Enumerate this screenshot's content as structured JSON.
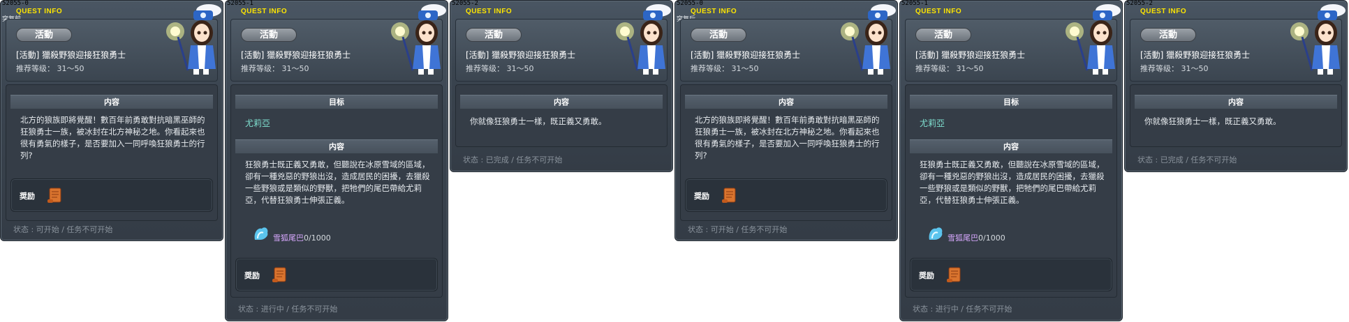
{
  "panels": [
    {
      "qid": "52055-0",
      "qinfo": "QUEST INFO",
      "subtag": "突复前",
      "badge": "活動",
      "title": "[活動] 獵殺野狼迎接狂狼勇士",
      "level": "推荐等级： 31～50",
      "content_header": "内容",
      "content": "北方的狼族即將覺醒！數百年前勇敢對抗暗黑巫師的狂狼勇士一族，被冰封在北方神秘之地。你看起來也很有勇氣的樣子，是否要加入一同呼喚狂狼勇士的行列?",
      "reward_label": "奨励",
      "status": "状态 : 可开始 / 任务不可开始"
    },
    {
      "qid": "52055-1",
      "qinfo": "QUEST INFO",
      "subtag": "",
      "badge": "活動",
      "title": "[活動] 獵殺野狼迎接狂狼勇士",
      "level": "推荐等级： 31～50",
      "target_header": "目标",
      "target_npc": "尤莉亞",
      "content_header": "内容",
      "content": "狂狼勇士既正義又勇敢，但聽說在冰原雪域的區域，卻有一種兇惡的野狼出沒，造成居民的困擾，去獵殺一些野狼或是類似的野獸，把牠們的尾巴帶給尤莉亞，代替狂狼勇士伸張正義。",
      "item_name": "雪狐尾巴",
      "item_count": "0/1000",
      "reward_label": "奨励",
      "status": "状态 : 进行中 / 任务不可开始"
    },
    {
      "qid": "52055-2",
      "qinfo": "QUEST INFO",
      "subtag": "",
      "badge": "活動",
      "title": "[活動] 獵殺野狼迎接狂狼勇士",
      "level": "推荐等级： 31～50",
      "content_header": "内容",
      "content": "你就像狂狼勇士一樣，既正義又勇敢。",
      "status": "状态 : 已完成 / 任务不可开始"
    },
    {
      "qid": "52055-0",
      "qinfo": "QUEST INFO",
      "subtag": "突复后",
      "badge": "活動",
      "title": "[活動] 獵殺野狼迎接狂狼勇士",
      "level": "推荐等级： 31～50",
      "content_header": "内容",
      "content": "北方的狼族即將覺醒！數百年前勇敢對抗暗黑巫師的狂狼勇士一族，被冰封在北方神秘之地。你看起來也很有勇氣的樣子，是否要加入一同呼喚狂狼勇士的行列?",
      "reward_label": "奨励",
      "status": "状态 : 可开始 / 任务不可开始"
    },
    {
      "qid": "52055-1",
      "qinfo": "QUEST INFO",
      "subtag": "",
      "badge": "活動",
      "title": "[活動] 獵殺野狼迎接狂狼勇士",
      "level": "推荐等级： 31～50",
      "target_header": "目标",
      "target_npc": "尤莉亞",
      "content_header": "内容",
      "content": "狂狼勇士既正義又勇敢，但聽說在冰原雪域的區域，卻有一種兇惡的野狼出沒，造成居民的困擾，去獵殺一些野狼或是類似的野獸，把牠們的尾巴帶給尤莉亞，代替狂狼勇士伸張正義。",
      "item_name": "雪狐尾巴",
      "item_count": "0/1000",
      "reward_label": "奨励",
      "status": "状态 : 进行中 / 任务不可开始"
    },
    {
      "qid": "52055-2",
      "qinfo": "QUEST INFO",
      "subtag": "",
      "badge": "活動",
      "title": "[活動] 獵殺野狼迎接狂狼勇士",
      "level": "推荐等级： 31～50",
      "content_header": "内容",
      "content": "你就像狂狼勇士一樣，既正義又勇敢。",
      "status": "状态 : 已完成 / 任务不可开始"
    }
  ],
  "colors": {
    "qinfo": "#ffe600",
    "target_npc": "#7fe0d0",
    "item_name": "#d8a8ff",
    "status": "#8a939c"
  }
}
